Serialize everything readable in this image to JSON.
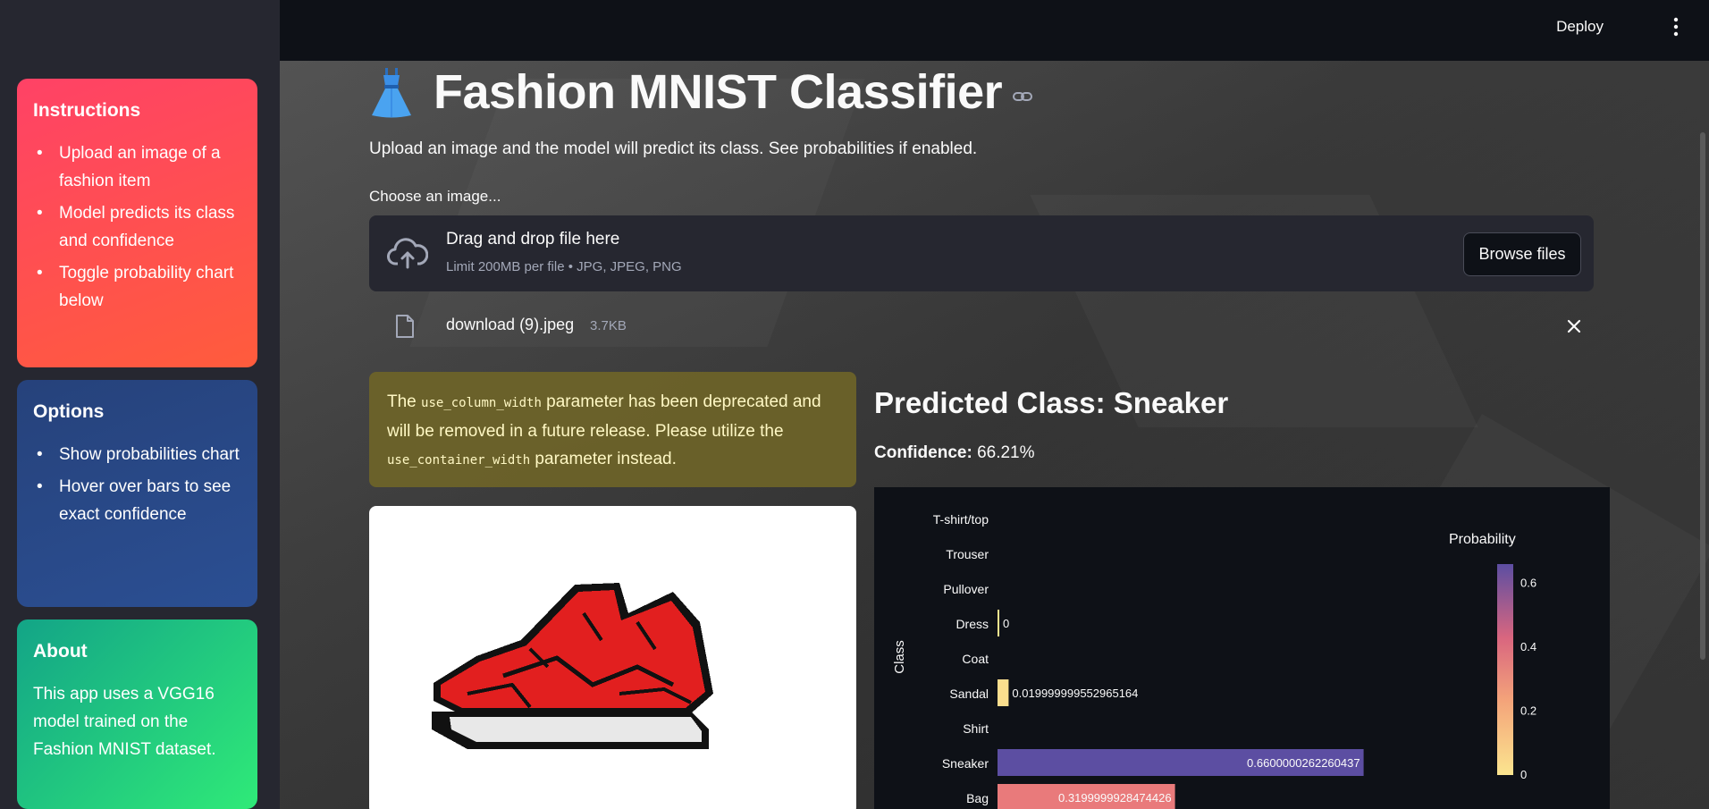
{
  "header": {
    "deploy_label": "Deploy",
    "menu_icon": "kebab-menu-icon"
  },
  "sidebar": {
    "instructions": {
      "title": "Instructions",
      "items": [
        "Upload an image of a fashion item",
        "Model predicts its class and confidence",
        "Toggle probability chart below"
      ]
    },
    "options": {
      "title": "Options",
      "items": [
        "Show probabilities chart",
        "Hover over bars to see exact confidence"
      ]
    },
    "about": {
      "title": "About",
      "text": "This app uses a VGG16 model trained on the Fashion MNIST dataset."
    }
  },
  "main": {
    "title": "Fashion MNIST Classifier",
    "subtitle": "Upload an image and the model will predict its class. See probabilities if enabled.",
    "uploader": {
      "label": "Choose an image...",
      "drop_text": "Drag and drop file here",
      "limit_text": "Limit 200MB per file • JPG, JPEG, PNG",
      "browse_label": "Browse files"
    },
    "file": {
      "name": "download (9).jpeg",
      "size": "3.7KB"
    },
    "warning": {
      "pre": "The ",
      "code1": "use_column_width",
      "mid": " parameter has been deprecated and will be removed in a future release. Please utilize the ",
      "code2": "use_container_width",
      "post": " parameter instead."
    },
    "prediction": {
      "title": "Predicted Class: Sneaker",
      "confidence_label": "Confidence:",
      "confidence_value": "66.21%"
    }
  },
  "chart_data": {
    "type": "bar",
    "orientation": "horizontal",
    "ylabel": "Class",
    "categories": [
      "T-shirt/top",
      "Trouser",
      "Pullover",
      "Dress",
      "Coat",
      "Sandal",
      "Shirt",
      "Sneaker",
      "Bag"
    ],
    "values": [
      null,
      null,
      null,
      0,
      null,
      0.019999999552965164,
      null,
      0.6600000262260437,
      0.3199999928474426
    ],
    "value_labels": [
      "",
      "",
      "",
      "0",
      "",
      "0.019999999552965164",
      "",
      "0.6600000262260437",
      "0.3199999928474426"
    ],
    "xlim": [
      0,
      0.68
    ],
    "colorbar": {
      "title": "Probability",
      "ticks": [
        "0.6",
        "0.4",
        "0.2",
        "0"
      ],
      "min": 0,
      "max": 0.66
    },
    "colors": {
      "low": "#fbe58f",
      "mid": "#e8777a",
      "high": "#5c4ea2"
    },
    "legend": "right"
  }
}
